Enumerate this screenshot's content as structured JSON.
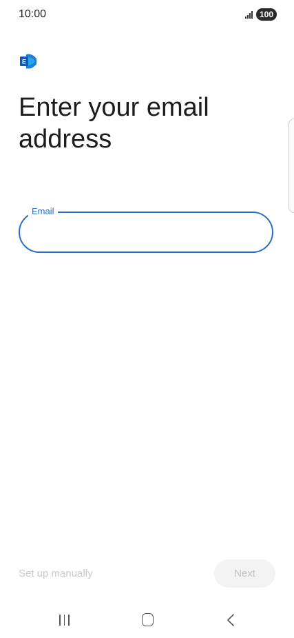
{
  "status_bar": {
    "time": "10:00",
    "battery": "100"
  },
  "app": {
    "logo_icon": "exchange-logo-icon",
    "logo_letter": "E"
  },
  "page": {
    "title": "Enter your email address"
  },
  "email_field": {
    "label": "Email",
    "value": ""
  },
  "footer": {
    "setup_manually": "Set up manually",
    "next": "Next"
  },
  "nav": {
    "recents_icon": "recents-icon",
    "home_icon": "home-icon",
    "back_icon": "back-icon"
  },
  "colors": {
    "accent": "#2a6fc9",
    "disabled_text": "#c2c2c2"
  }
}
